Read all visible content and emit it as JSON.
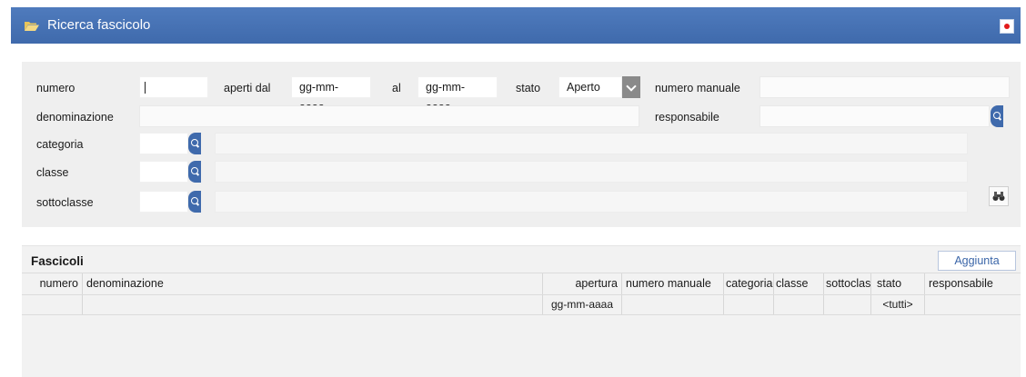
{
  "window": {
    "title": "Ricerca fascicolo",
    "folder_icon": "folder-open-icon",
    "close_icon": "close-icon",
    "brand_color": "#3f6aac"
  },
  "search": {
    "numero_label": "numero",
    "numero_value": "",
    "aperti_dal_label": "aperti dal",
    "aperti_dal_placeholder": "gg-mm-aaaa",
    "al_label": "al",
    "al_placeholder": "gg-mm-aaaa",
    "stato_label": "stato",
    "stato_value": "Aperto",
    "numero_manuale_label": "numero manuale",
    "numero_manuale_value": "",
    "denominazione_label": "denominazione",
    "denominazione_value": "",
    "responsabile_label": "responsabile",
    "responsabile_value": "",
    "categoria_label": "categoria",
    "classe_label": "classe",
    "sottoclasse_label": "sottoclasse",
    "lookup_icon": "search-icon",
    "find_icon": "binoculars-icon"
  },
  "results": {
    "title": "Fascicoli",
    "add_label": "Aggiunta",
    "columns": [
      "numero",
      "denominazione",
      "apertura",
      "numero manuale",
      "categoria",
      "classe",
      "sottoclas:",
      "stato",
      "responsabile"
    ],
    "filters": {
      "apertura": "gg-mm-aaaa",
      "stato": "<tutti>"
    },
    "rows": []
  }
}
